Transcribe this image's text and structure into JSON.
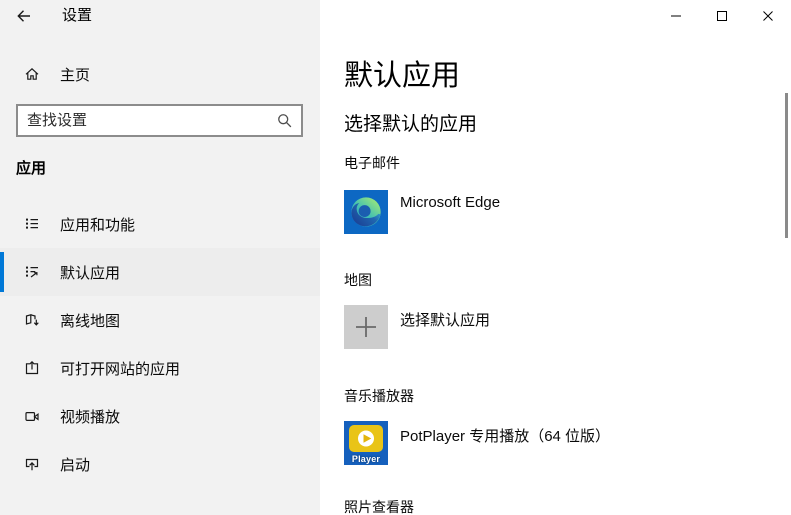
{
  "window": {
    "title": "设置",
    "controls": {
      "minimize": "minimize-icon",
      "maximize": "maximize-icon",
      "close": "close-icon"
    }
  },
  "colors": {
    "accent": "#0078d7",
    "sidebar_bg": "#f2f2f2",
    "main_bg": "#ffffff",
    "search_border": "#8c8c8c",
    "plus_tile_bg": "#cdcdcd",
    "edge_tile_blue": "#0d68c3",
    "potplayer_blue": "#1560bd",
    "potplayer_yellow": "#e9c417",
    "scrollbar_thumb": "#8a8a8a"
  },
  "sidebar": {
    "home_label": "主页",
    "search_placeholder": "查找设置",
    "section_header": "应用",
    "items": [
      {
        "label": "应用和功能",
        "icon": "apps-features-icon",
        "selected": false
      },
      {
        "label": "默认应用",
        "icon": "default-apps-icon",
        "selected": true
      },
      {
        "label": "离线地图",
        "icon": "offline-maps-icon",
        "selected": false
      },
      {
        "label": "可打开网站的应用",
        "icon": "apps-for-websites-icon",
        "selected": false
      },
      {
        "label": "视频播放",
        "icon": "video-playback-icon",
        "selected": false
      },
      {
        "label": "启动",
        "icon": "startup-icon",
        "selected": false
      }
    ]
  },
  "main": {
    "title": "默认应用",
    "subtitle": "选择默认的应用",
    "categories": [
      {
        "label": "电子邮件",
        "app": "Microsoft Edge",
        "icon": "microsoft-edge-icon"
      },
      {
        "label": "地图",
        "app": "选择默认应用",
        "icon": "plus-icon"
      },
      {
        "label": "音乐播放器",
        "app": "PotPlayer 专用播放（64 位版）",
        "icon": "potplayer-icon"
      },
      {
        "label": "照片查看器"
      }
    ],
    "potplayer_badge": "Player"
  }
}
